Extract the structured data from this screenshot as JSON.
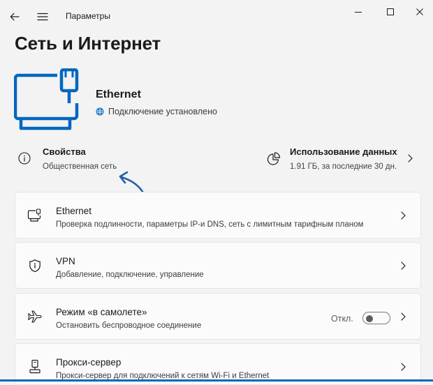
{
  "window": {
    "title": "Параметры"
  },
  "page": {
    "title": "Сеть и Интернет"
  },
  "hero": {
    "name": "Ethernet",
    "status": "Подключение установлено"
  },
  "properties": {
    "title": "Свойства",
    "subtitle": "Общественная сеть"
  },
  "data_usage": {
    "title": "Использование данных",
    "subtitle": "1.91 ГБ, за последние 30 дн."
  },
  "cards": [
    {
      "title": "Ethernet",
      "subtitle": "Проверка подлинности, параметры IP-и DNS, сеть с лимитным тарифным планом",
      "icon": "ethernet-monitor-icon"
    },
    {
      "title": "VPN",
      "subtitle": "Добавление, подключение, управление",
      "icon": "shield-icon"
    },
    {
      "title": "Режим «в самолете»",
      "subtitle": "Остановить беспроводное соединение",
      "icon": "airplane-icon",
      "toggle_label": "Откл.",
      "toggle_on": false
    },
    {
      "title": "Прокси-сервер",
      "subtitle": "Прокси-сервер для подключений к сетям Wi-Fi и Ethernet",
      "icon": "proxy-icon"
    }
  ],
  "colors": {
    "accent": "#0067c0",
    "background": "#f3f3f3",
    "card": "#fbfbfb"
  }
}
